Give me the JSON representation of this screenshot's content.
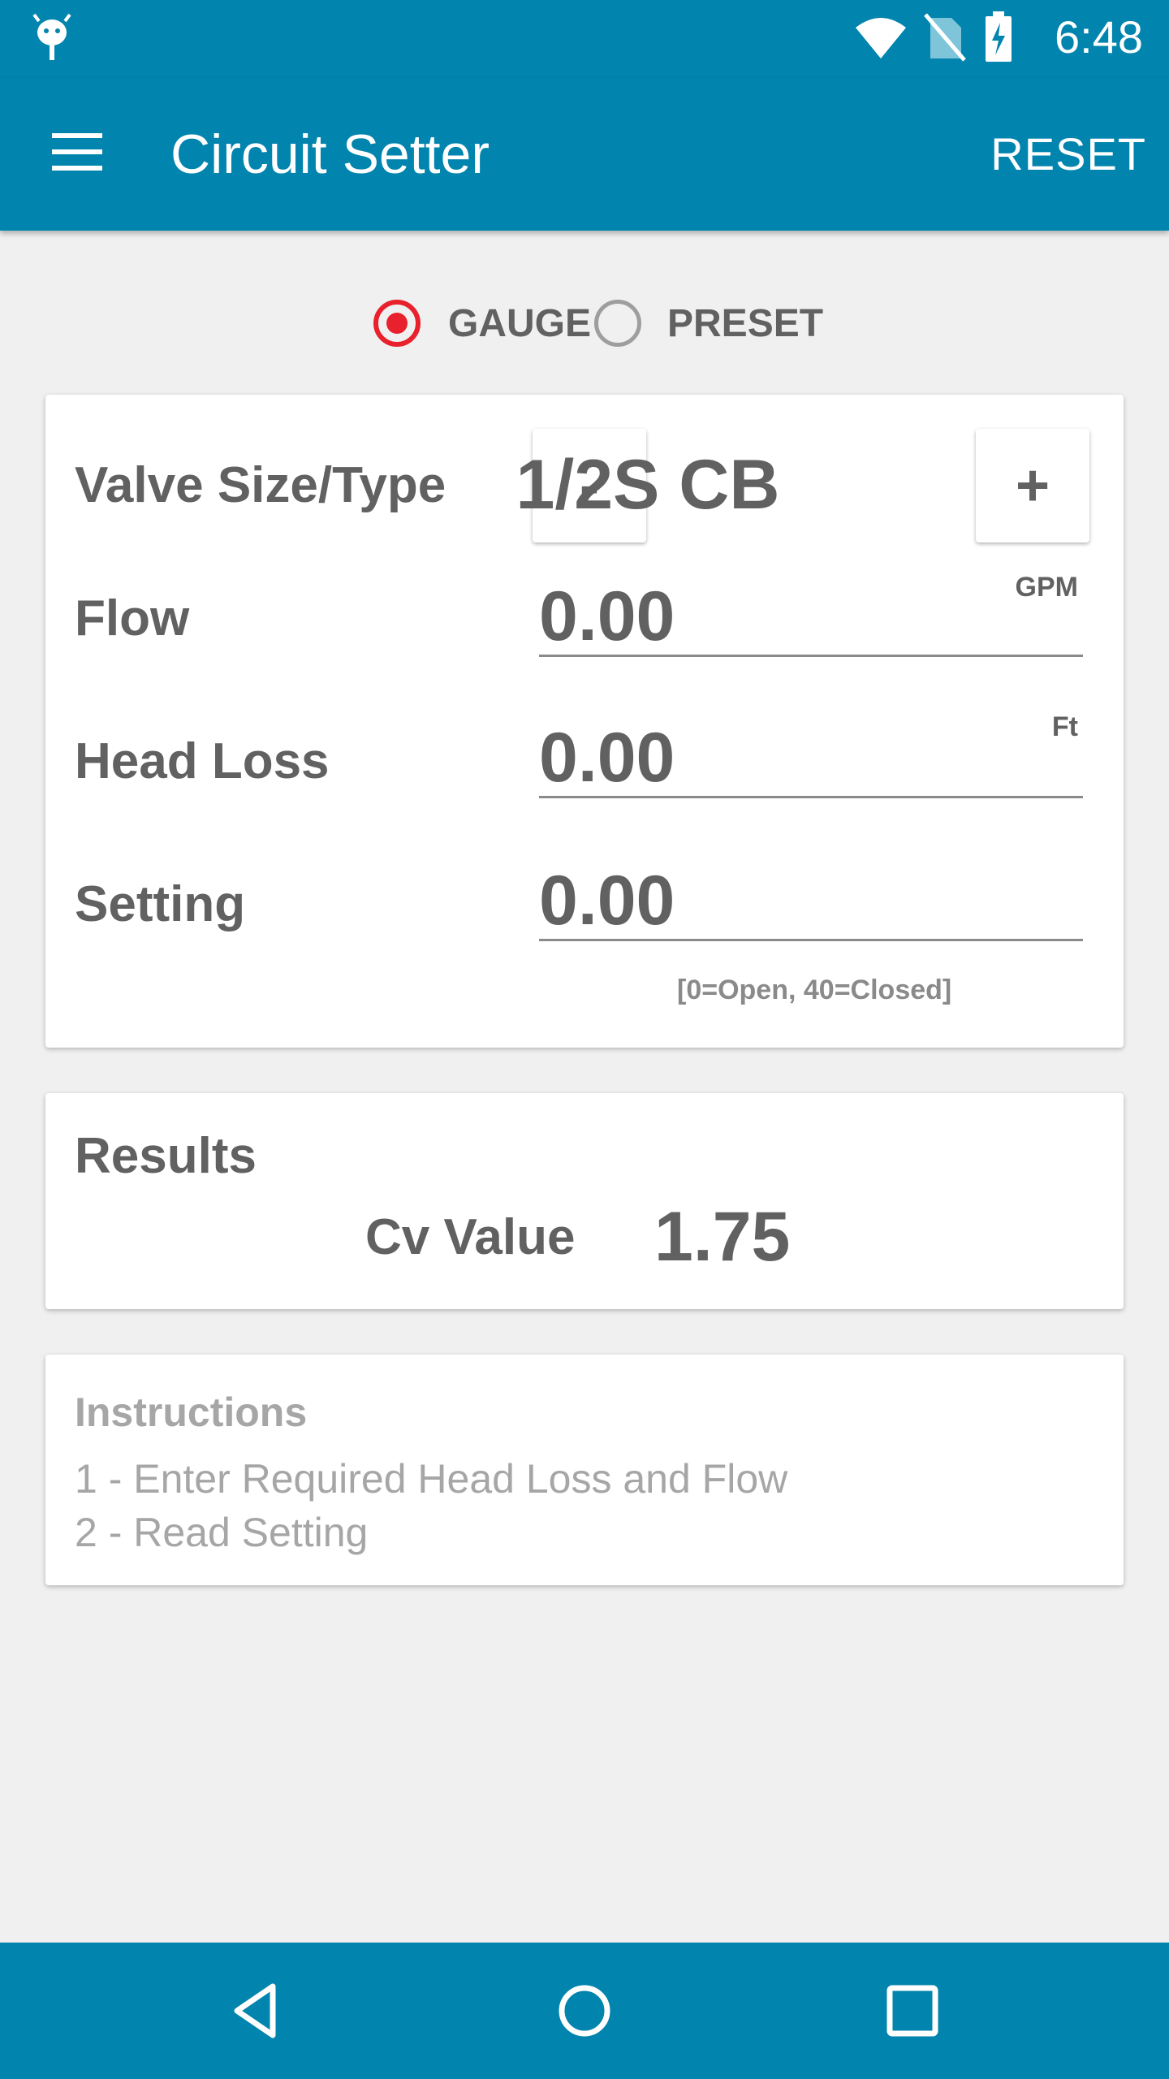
{
  "status_bar": {
    "time": "6:48"
  },
  "app_bar": {
    "title": "Circuit Setter",
    "reset_label": "RESET"
  },
  "mode": {
    "options": [
      {
        "label": "GAUGE",
        "selected": true
      },
      {
        "label": "PRESET",
        "selected": false
      }
    ]
  },
  "inputs": {
    "valve": {
      "label": "Valve Size/Type",
      "value": "1/2S CB",
      "decrement": "-",
      "increment": "+"
    },
    "flow": {
      "label": "Flow",
      "value": "0.00",
      "unit": "GPM"
    },
    "head_loss": {
      "label": "Head Loss",
      "value": "0.00",
      "unit": "Ft"
    },
    "setting": {
      "label": "Setting",
      "value": "0.00",
      "hint": "[0=Open, 40=Closed]"
    }
  },
  "results": {
    "title": "Results",
    "cv_label": "Cv Value",
    "cv_value": "1.75"
  },
  "instructions": {
    "title": "Instructions",
    "lines": [
      "1 - Enter Required Head Loss and Flow",
      "2 - Read Setting"
    ]
  },
  "colors": {
    "primary": "#0184ad",
    "accent": "#e8212c",
    "background": "#f0f0f0",
    "text": "#616161"
  }
}
